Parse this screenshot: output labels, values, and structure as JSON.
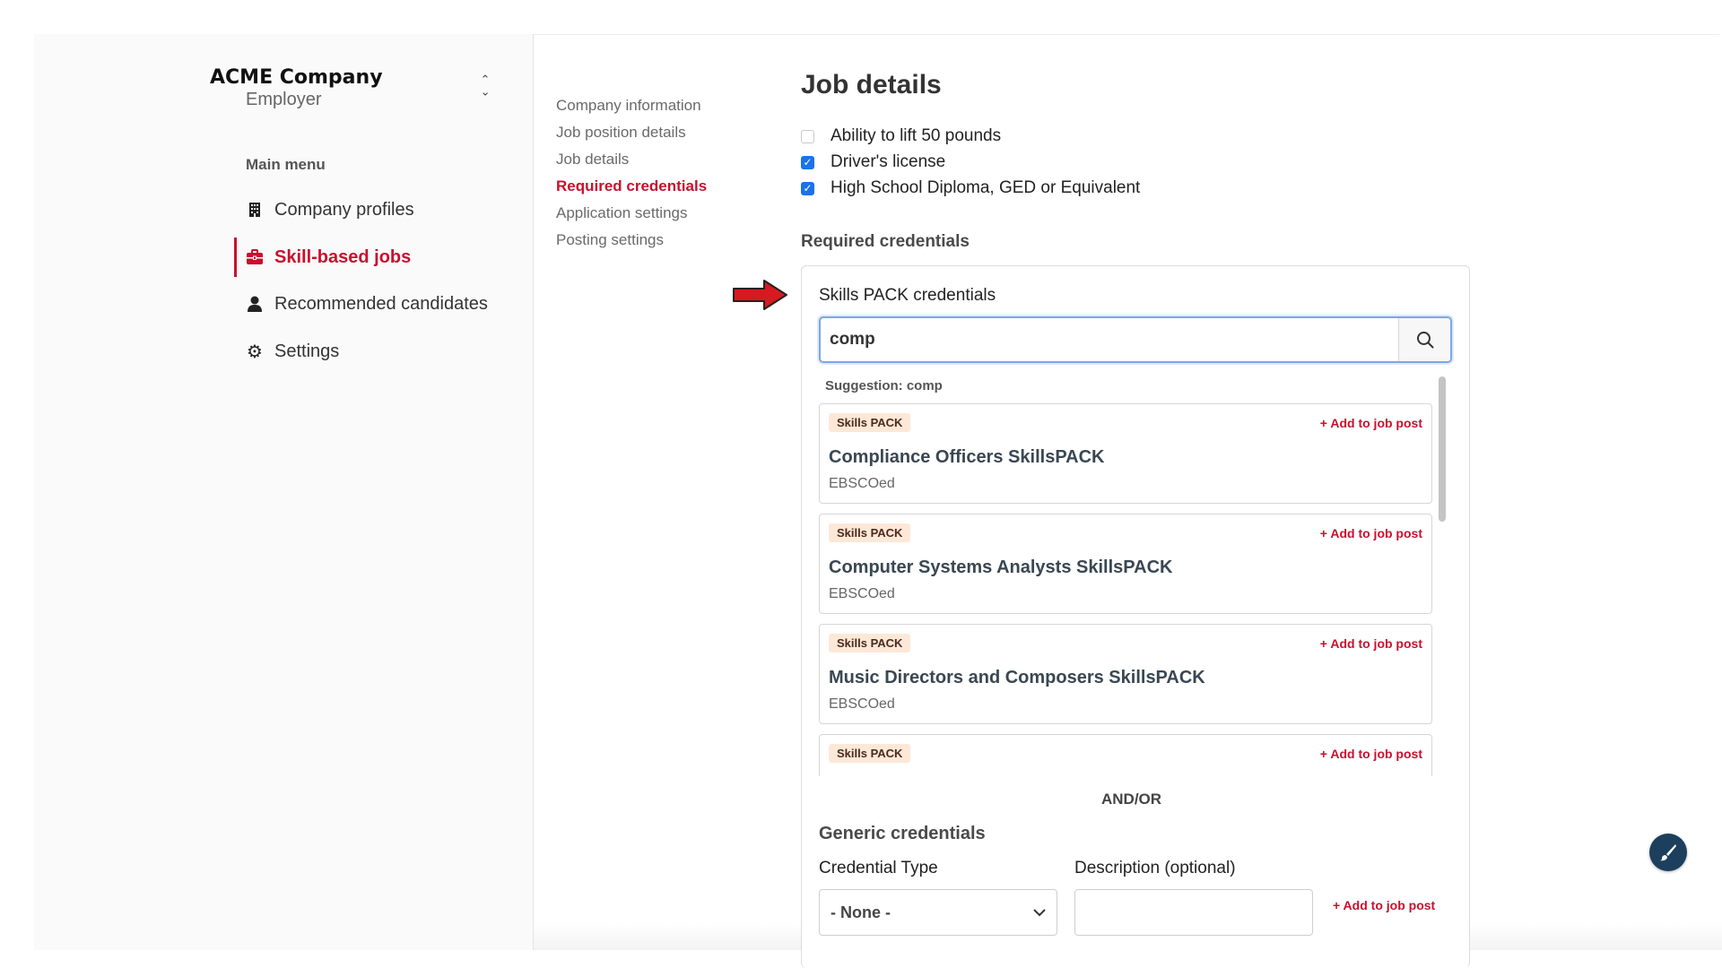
{
  "company": {
    "name": "ACME Company",
    "role": "Employer"
  },
  "main_menu": {
    "heading": "Main menu",
    "items": [
      {
        "label": "Company profiles",
        "icon": "building-icon"
      },
      {
        "label": "Skill-based jobs",
        "icon": "briefcase-icon",
        "active": true
      },
      {
        "label": "Recommended candidates",
        "icon": "user-icon"
      },
      {
        "label": "Settings",
        "icon": "gear-icon"
      }
    ]
  },
  "subnav": {
    "items": [
      {
        "label": "Company information"
      },
      {
        "label": "Job position details"
      },
      {
        "label": "Job details"
      },
      {
        "label": "Required credentials",
        "active": true
      },
      {
        "label": "Application settings"
      },
      {
        "label": "Posting settings"
      }
    ]
  },
  "job_details": {
    "title": "Job details",
    "requirements": [
      {
        "label": "Ability to lift 50 pounds",
        "checked": false
      },
      {
        "label": "Driver's license",
        "checked": true
      },
      {
        "label": "High School Diploma, GED or Equivalent",
        "checked": true
      }
    ]
  },
  "required_credentials": {
    "heading": "Required credentials",
    "skills_pack_label": "Skills PACK credentials",
    "search_value": "comp",
    "suggestion_text": "Suggestion: comp",
    "results": [
      {
        "badge": "Skills PACK",
        "add_label": "Add to job post",
        "title": "Compliance Officers SkillsPACK",
        "provider": "EBSCOed"
      },
      {
        "badge": "Skills PACK",
        "add_label": "Add to job post",
        "title": "Computer Systems Analysts SkillsPACK",
        "provider": "EBSCOed"
      },
      {
        "badge": "Skills PACK",
        "add_label": "Add to job post",
        "title": "Music Directors and Composers SkillsPACK",
        "provider": "EBSCOed"
      },
      {
        "badge": "Skills PACK",
        "add_label": "Add to job post",
        "title": "",
        "provider": ""
      }
    ],
    "andor_label": "AND/OR",
    "generic": {
      "heading": "Generic credentials",
      "credential_type_label": "Credential Type",
      "credential_type_value": "- None -",
      "description_label": "Description (optional)",
      "description_value": "",
      "add_label": "Add to job post"
    }
  },
  "colors": {
    "accent": "#c8102e",
    "checkbox": "#1a73e8",
    "focus": "#7ba6e8",
    "badge_bg": "#fde8d8",
    "fab": "#1c3f5e"
  }
}
